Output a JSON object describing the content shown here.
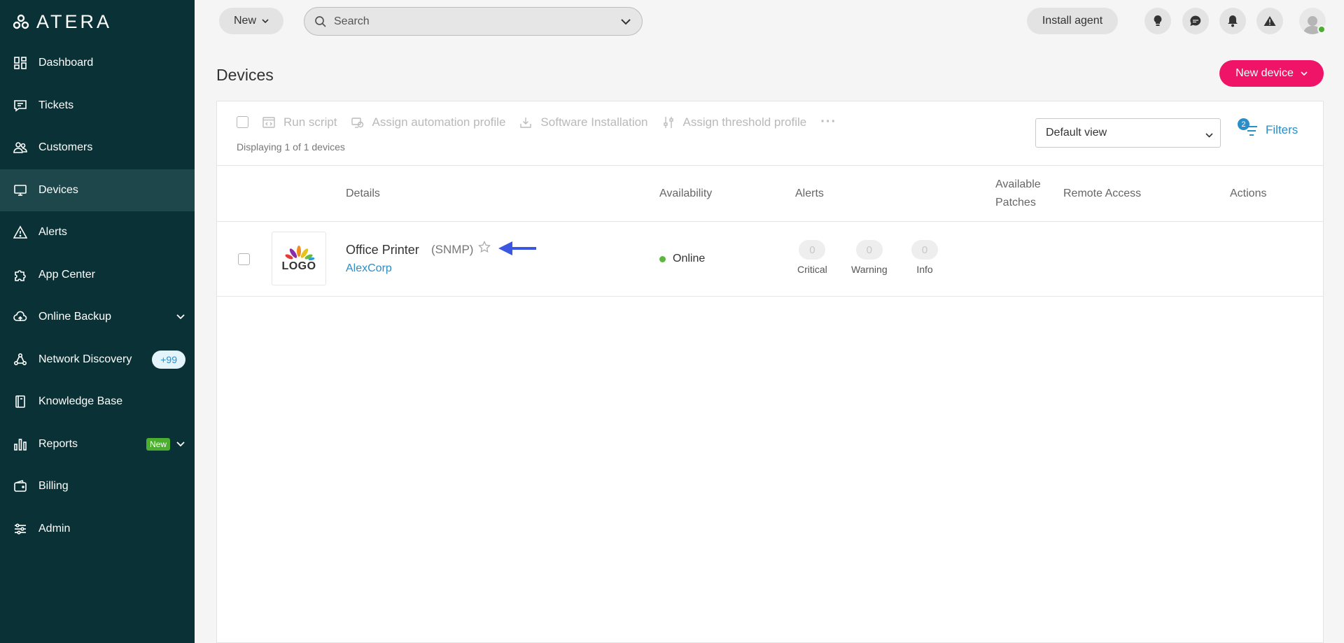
{
  "brand": {
    "name": "ATERA"
  },
  "sidebar": {
    "items": [
      {
        "label": "Dashboard",
        "icon": "dashboard-icon"
      },
      {
        "label": "Tickets",
        "icon": "ticket-icon"
      },
      {
        "label": "Customers",
        "icon": "customers-icon"
      },
      {
        "label": "Devices",
        "icon": "devices-icon",
        "active": true
      },
      {
        "label": "Alerts",
        "icon": "alert-triangle-icon"
      },
      {
        "label": "App Center",
        "icon": "puzzle-icon"
      },
      {
        "label": "Online Backup",
        "icon": "cloud-icon"
      },
      {
        "label": "Network Discovery",
        "icon": "network-icon",
        "badge": "+99"
      },
      {
        "label": "Knowledge Base",
        "icon": "book-icon"
      },
      {
        "label": "Reports",
        "icon": "bar-chart-icon",
        "badge": "New"
      },
      {
        "label": "Billing",
        "icon": "wallet-icon"
      },
      {
        "label": "Admin",
        "icon": "sliders-icon"
      }
    ]
  },
  "topbar": {
    "new_label": "New",
    "search_placeholder": "Search",
    "install_label": "Install agent"
  },
  "page": {
    "title": "Devices",
    "new_device_label": "New device"
  },
  "toolbar": {
    "run_script": "Run script",
    "assign_automation": "Assign automation profile",
    "software_install": "Software Installation",
    "assign_threshold": "Assign threshold profile",
    "more": "···",
    "display_count": "Displaying 1 of 1 devices",
    "view_selected": "Default view",
    "filters_label": "Filters",
    "filters_count": "2"
  },
  "table": {
    "headers": {
      "details": "Details",
      "availability": "Availability",
      "alerts": "Alerts",
      "patches_line1": "Available",
      "patches_line2": "Patches",
      "remote": "Remote Access",
      "actions": "Actions"
    },
    "rows": [
      {
        "logo_text": "LOGO",
        "name": "Office Printer",
        "type": "(SNMP)",
        "customer": "AlexCorp",
        "availability": "Online",
        "alerts": {
          "critical": {
            "count": "0",
            "label": "Critical"
          },
          "warning": {
            "count": "0",
            "label": "Warning"
          },
          "info": {
            "count": "0",
            "label": "Info"
          }
        }
      }
    ]
  },
  "colors": {
    "sidebar_bg": "#0a3236",
    "accent": "#ef1467",
    "link": "#2b8ec9",
    "online": "#5bb83d"
  }
}
